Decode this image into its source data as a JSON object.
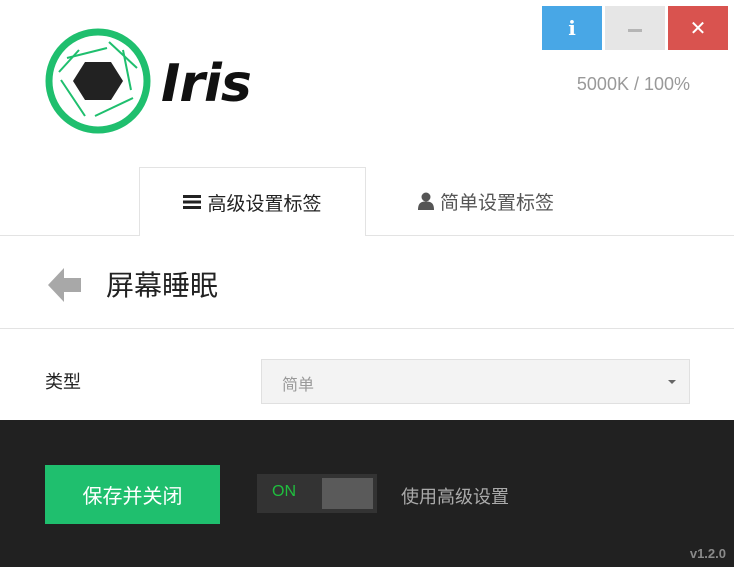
{
  "window": {
    "controls": {
      "info_icon": "info-icon",
      "minimize_icon": "minimize-icon",
      "close_icon": "close-icon",
      "info_color": "#48a7e6",
      "minimize_color": "#e6e6e6",
      "close_color": "#d9534f"
    }
  },
  "brand": {
    "name": "Iris",
    "logo_icon": "aperture-logo-icon",
    "accent_color": "#1fbf6e"
  },
  "header": {
    "readout": "5000K / 100%"
  },
  "tabs": [
    {
      "label": "高级设置标签",
      "icon": "menu-lines-icon",
      "active": true
    },
    {
      "label": "简单设置标签",
      "icon": "user-icon",
      "active": false
    }
  ],
  "section": {
    "back_icon": "back-arrow-icon",
    "title": "屏幕睡眠"
  },
  "form": {
    "type_label": "类型",
    "type_select": {
      "value": "简单",
      "icon": "caret-down-icon"
    }
  },
  "footer": {
    "save_label": "保存并关闭",
    "toggle": {
      "state_label": "ON",
      "on": true
    },
    "advanced_label": "使用高级设置",
    "version": "v1.2.0"
  }
}
